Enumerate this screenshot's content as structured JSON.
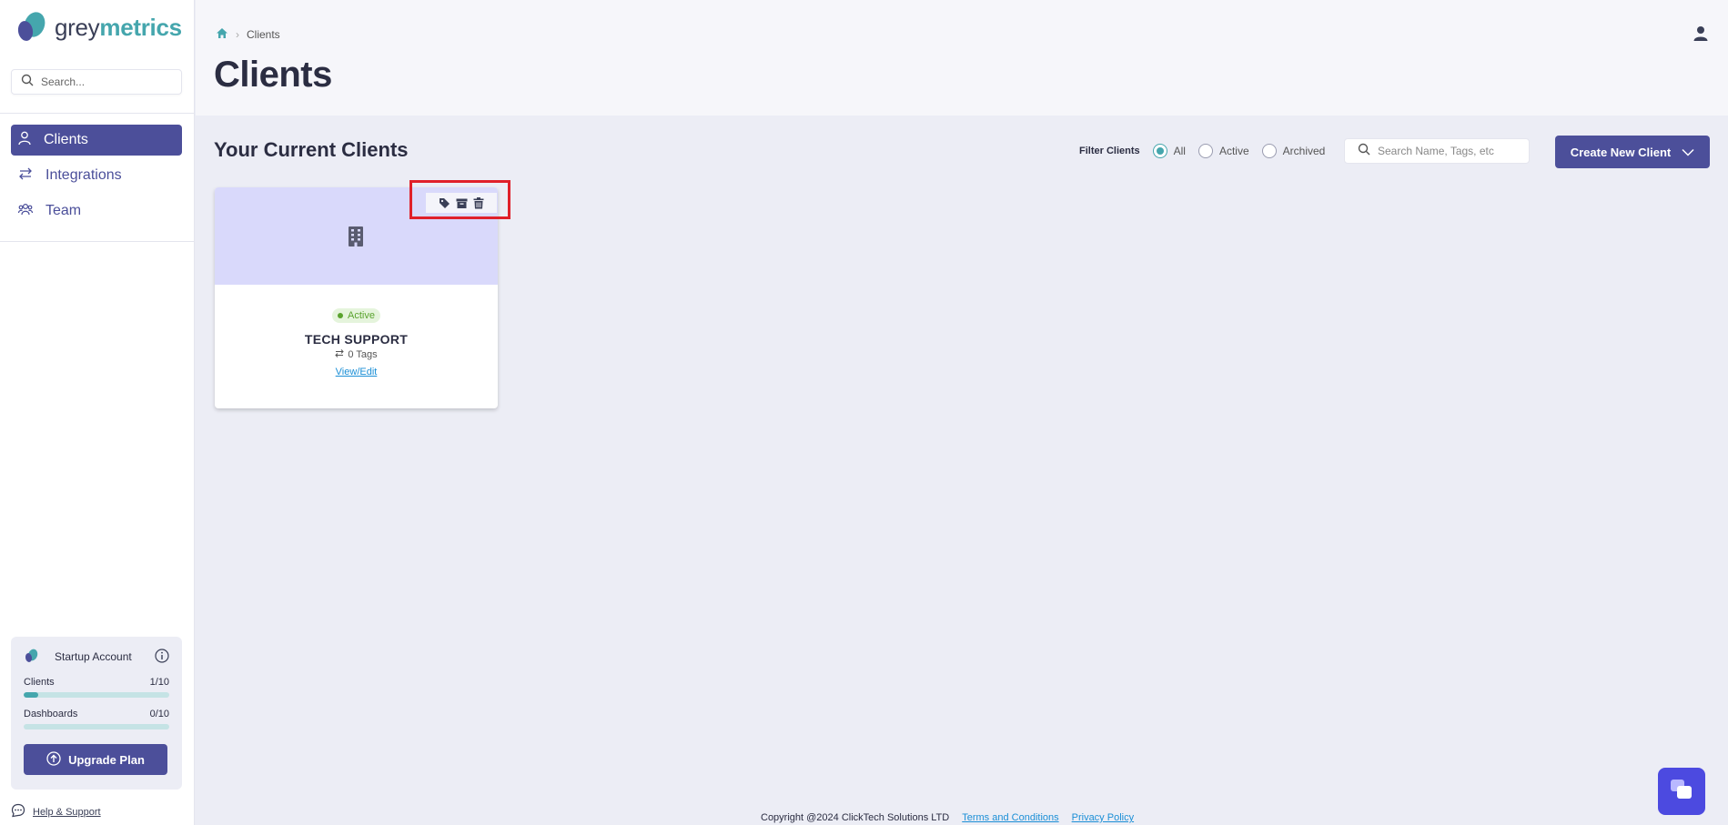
{
  "brand": {
    "grey": "grey",
    "metrics": "metrics"
  },
  "sidebar": {
    "search_placeholder": "Search...",
    "items": [
      {
        "label": "Clients",
        "icon": "user-icon",
        "active": true
      },
      {
        "label": "Integrations",
        "icon": "arrows-swap-icon",
        "active": false
      },
      {
        "label": "Team",
        "icon": "team-icon",
        "active": false
      }
    ],
    "account": {
      "plan": "Startup Account",
      "clients_label": "Clients",
      "clients_value": "1/10",
      "clients_fraction": 0.1,
      "dashboards_label": "Dashboards",
      "dashboards_value": "0/10",
      "dashboards_fraction": 0,
      "upgrade_label": "Upgrade Plan"
    },
    "help_label": "Help & Support"
  },
  "header": {
    "breadcrumb_current": "Clients",
    "title": "Clients"
  },
  "main": {
    "section_title": "Your Current Clients",
    "filter": {
      "label": "Filter Clients",
      "options": [
        "All",
        "Active",
        "Archived"
      ],
      "selected": "All"
    },
    "search_placeholder": "Search Name, Tags, etc",
    "create_label": "Create New Client",
    "clients": [
      {
        "status": "Active",
        "name": "TECH SUPPORT",
        "tags": "0 Tags",
        "link": "View/Edit"
      }
    ]
  },
  "footer": {
    "copyright": "Copyright @2024 ClickTech Solutions LTD",
    "terms": "Terms and Conditions",
    "privacy": "Privacy Policy"
  },
  "colors": {
    "primary": "#4c4f9a",
    "accent": "#45a6ad",
    "card_header": "#d9d9fb",
    "active_badge": "#5aa32e",
    "highlight": "#e0202a"
  }
}
